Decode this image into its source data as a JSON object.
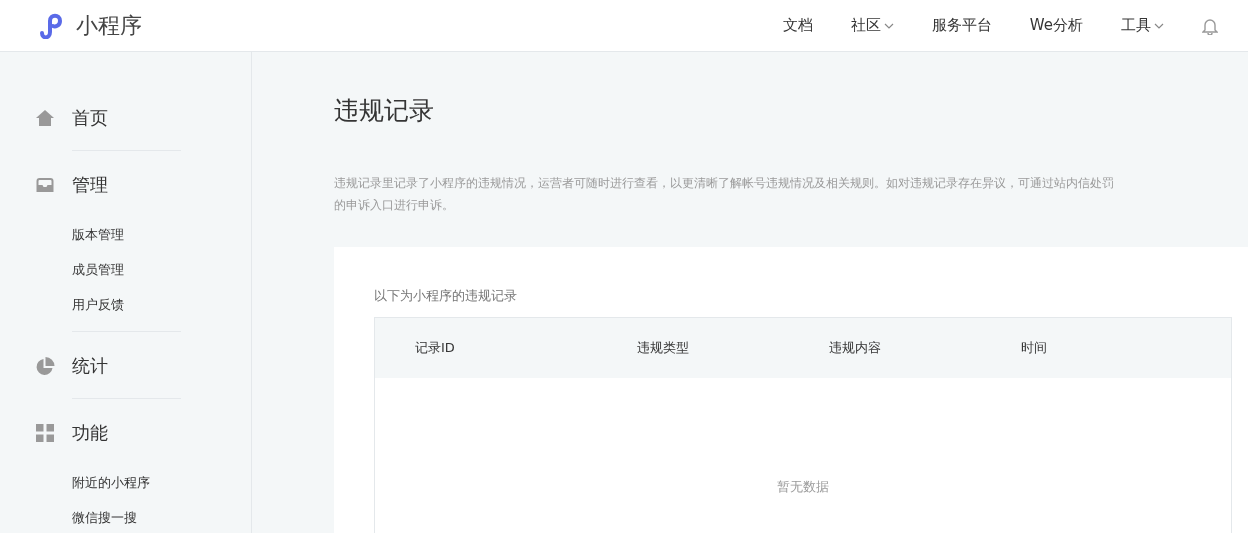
{
  "header": {
    "logo_text": "小程序",
    "nav": [
      {
        "label": "文档",
        "dropdown": false
      },
      {
        "label": "社区",
        "dropdown": true
      },
      {
        "label": "服务平台",
        "dropdown": false
      },
      {
        "label": "We分析",
        "dropdown": false
      },
      {
        "label": "工具",
        "dropdown": true
      }
    ]
  },
  "sidebar": {
    "groups": [
      {
        "kind": "home",
        "label": "首页"
      },
      {
        "kind": "manage",
        "label": "管理",
        "children": [
          "版本管理",
          "成员管理",
          "用户反馈"
        ]
      },
      {
        "kind": "stats",
        "label": "统计"
      },
      {
        "kind": "features",
        "label": "功能",
        "children": [
          "附近的小程序",
          "微信搜一搜"
        ]
      }
    ]
  },
  "main": {
    "title": "违规记录",
    "description_lines": [
      "违规记录里记录了小程序的违规情况，运营者可随时进行查看，以更清晰了解帐号违规情况及相关规则。如对违规记录存在异议，可通过站内信处罚",
      "的申诉入口进行申诉。"
    ],
    "card": {
      "caption": "以下为小程序的违规记录",
      "table": {
        "columns": [
          "记录ID",
          "违规类型",
          "违规内容",
          "时间"
        ],
        "empty_text": "暂无数据"
      }
    }
  }
}
